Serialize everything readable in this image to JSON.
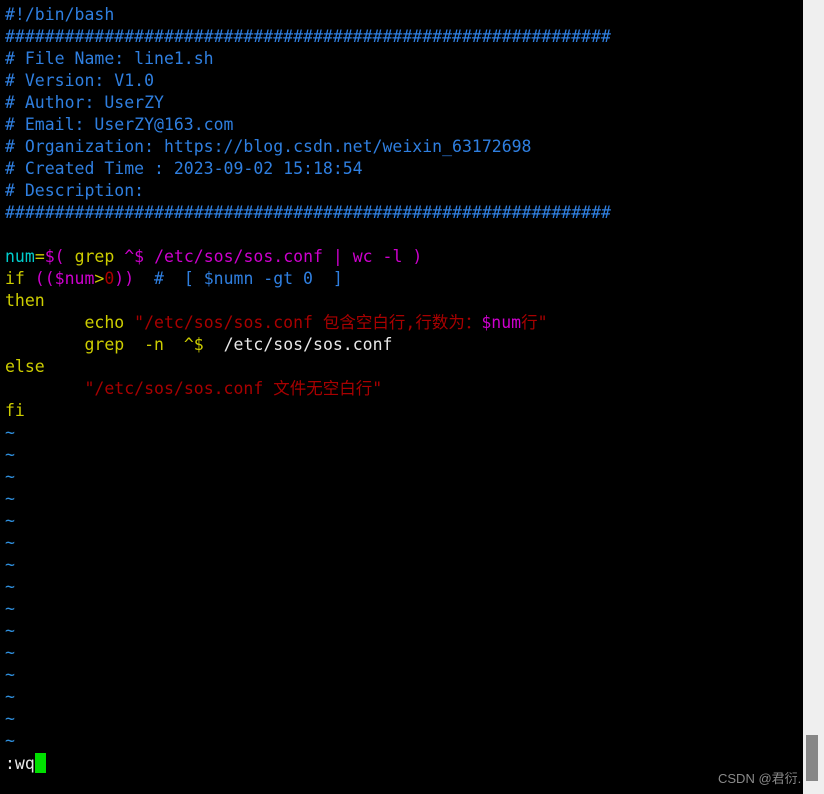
{
  "editor": {
    "app": "vim",
    "background_color": "#000000",
    "foreground_color": "#e8e8e8",
    "cursor_color": "#00e000",
    "sidebar_color": "#efefef",
    "scrollbar_color": "#878787"
  },
  "script": {
    "shebang": "#!/bin/bash",
    "separator": "#############################################################",
    "header": {
      "file_name": "# File Name: line1.sh",
      "version": "# Version: V1.0",
      "author": "# Author: UserZY",
      "email": "# Email: UserZY@163.com",
      "organization": "# Organization: https://blog.csdn.net/weixin_63172698",
      "created_time": "# Created Time : 2023-09-02 15:18:54",
      "description": "# Description:"
    },
    "body": {
      "assign_var": "num",
      "assign_eq": "=",
      "assign_open": "$( ",
      "assign_grep": "grep",
      "assign_pattern": " ^$ ",
      "assign_path": "/etc/sos/sos.conf | wc -l ",
      "assign_close": ")",
      "if_keyword": "if",
      "if_cond_open": " (($num",
      "if_cond_op": ">",
      "if_cond_value": "0",
      "if_cond_close": "))",
      "if_comment": "  #  [ $numn -gt 0  ]",
      "then_keyword": "then",
      "echo_keyword": "echo",
      "echo_string": "\"/etc/sos/sos.conf 包含空白行,行数为：",
      "echo_var": "$num",
      "echo_string_tail": "行\"",
      "grep_keyword": "grep",
      "grep_flag": "  -n",
      "grep_pattern": "  ^$",
      "grep_path": "  /etc/sos/sos.conf",
      "else_keyword": "else",
      "else_string": "\"/etc/sos/sos.conf 文件无空白行\"",
      "fi_keyword": "fi"
    },
    "empty_line_marker": "~",
    "empty_line_count": 15
  },
  "command_line": {
    "text": ":wq"
  },
  "watermark": {
    "text": "CSDN @君衍."
  }
}
